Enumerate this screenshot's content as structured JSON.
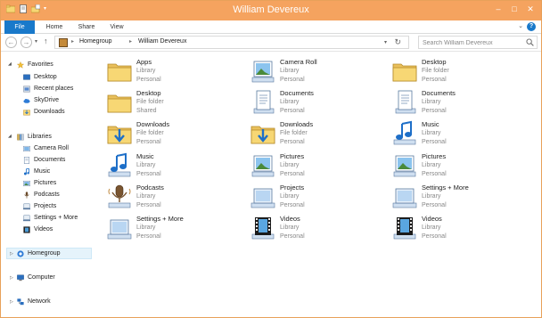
{
  "window": {
    "title": "William Devereux"
  },
  "colors": {
    "titlebar": "#f5a35f",
    "file_tab": "#1979ca",
    "selection": "#e5f3fb"
  },
  "ribbon": {
    "tabs": [
      "File",
      "Home",
      "Share",
      "View"
    ],
    "help": "?"
  },
  "address": {
    "crumbs": [
      "Homegroup",
      "William Devereux"
    ],
    "search_placeholder": "Search William Devereux"
  },
  "nav": {
    "favorites": {
      "label": "Favorites",
      "items": [
        "Desktop",
        "Recent places",
        "SkyDrive",
        "Downloads"
      ]
    },
    "libraries": {
      "label": "Libraries",
      "items": [
        "Camera Roll",
        "Documents",
        "Music",
        "Pictures",
        "Podcasts",
        "Projects",
        "Settings + More",
        "Videos"
      ]
    },
    "homegroup": "Homegroup",
    "computer": "Computer",
    "network": "Network"
  },
  "items": [
    {
      "name": "Apps",
      "type": "Library",
      "location": "Personal",
      "icon": "library-folder-icon"
    },
    {
      "name": "Camera Roll",
      "type": "Library",
      "location": "Personal",
      "icon": "pictures-library-icon"
    },
    {
      "name": "Desktop",
      "type": "File folder",
      "location": "Personal",
      "icon": "folder-icon"
    },
    {
      "name": "Desktop",
      "type": "File folder",
      "location": "Shared",
      "icon": "folder-icon"
    },
    {
      "name": "Documents",
      "type": "Library",
      "location": "Personal",
      "icon": "documents-library-icon"
    },
    {
      "name": "Documents",
      "type": "Library",
      "location": "Personal",
      "icon": "documents-library-icon"
    },
    {
      "name": "Downloads",
      "type": "File folder",
      "location": "Personal",
      "icon": "downloads-folder-icon"
    },
    {
      "name": "Downloads",
      "type": "File folder",
      "location": "Personal",
      "icon": "downloads-folder-icon"
    },
    {
      "name": "Music",
      "type": "Library",
      "location": "Personal",
      "icon": "music-library-icon"
    },
    {
      "name": "Music",
      "type": "Library",
      "location": "Personal",
      "icon": "music-library-icon"
    },
    {
      "name": "Pictures",
      "type": "Library",
      "location": "Personal",
      "icon": "pictures-library-icon"
    },
    {
      "name": "Pictures",
      "type": "Library",
      "location": "Personal",
      "icon": "pictures-library-icon"
    },
    {
      "name": "Podcasts",
      "type": "Library",
      "location": "Personal",
      "icon": "podcasts-library-icon"
    },
    {
      "name": "Projects",
      "type": "Library",
      "location": "Personal",
      "icon": "library-icon"
    },
    {
      "name": "Settings + More",
      "type": "Library",
      "location": "Personal",
      "icon": "library-icon"
    },
    {
      "name": "Settings + More",
      "type": "Library",
      "location": "Personal",
      "icon": "library-icon"
    },
    {
      "name": "Videos",
      "type": "Library",
      "location": "Personal",
      "icon": "videos-library-icon"
    },
    {
      "name": "Videos",
      "type": "Library",
      "location": "Personal",
      "icon": "videos-library-icon"
    }
  ]
}
